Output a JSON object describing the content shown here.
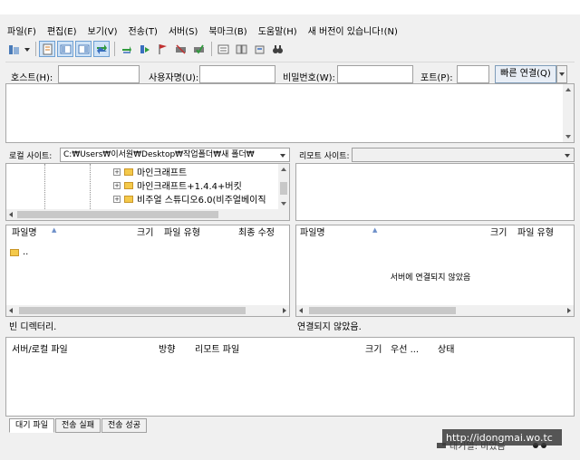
{
  "menu": [
    "파일(F)",
    "편집(E)",
    "보기(V)",
    "전송(T)",
    "서버(S)",
    "북마크(B)",
    "도움말(H)",
    "새 버전이 있습니다!(N)"
  ],
  "quickconnect": {
    "host_label": "호스트(H):",
    "user_label": "사용자명(U):",
    "pass_label": "비밀번호(W):",
    "port_label": "포트(P):",
    "connect_button": "빠른 연결(Q)"
  },
  "local": {
    "site_label": "로컬 사이트:",
    "path": "C:₩Users₩이서원₩Desktop₩작업폴더₩새 폴더₩",
    "tree": [
      "마인크래프트",
      "마인크래프트+1.4.4+버킷",
      "비주얼 스튜디오6.0(비주얼베이직"
    ],
    "columns": [
      "파일명",
      "크기",
      "파일 유형",
      "최종 수정"
    ],
    "files": [
      ".."
    ],
    "status": "빈 디렉터리."
  },
  "remote": {
    "site_label": "리모트 사이트:",
    "columns": [
      "파일명",
      "크기",
      "파일 유형"
    ],
    "empty_message": "서버에 연결되지 않았음",
    "status": "연결되지 않았음."
  },
  "queue": {
    "columns": [
      "서버/로컬 파일",
      "방향",
      "리모트 파일",
      "크기",
      "우선 ...",
      "상태"
    ],
    "tabs": [
      "대기 파일",
      "전송 실패",
      "전송 성공"
    ],
    "status_text": "대기열: 비었음"
  },
  "watermark": "http://idongmai.wo.tc",
  "colors": {
    "accent": "#6d9fd2",
    "folder": "#f4c94a"
  }
}
